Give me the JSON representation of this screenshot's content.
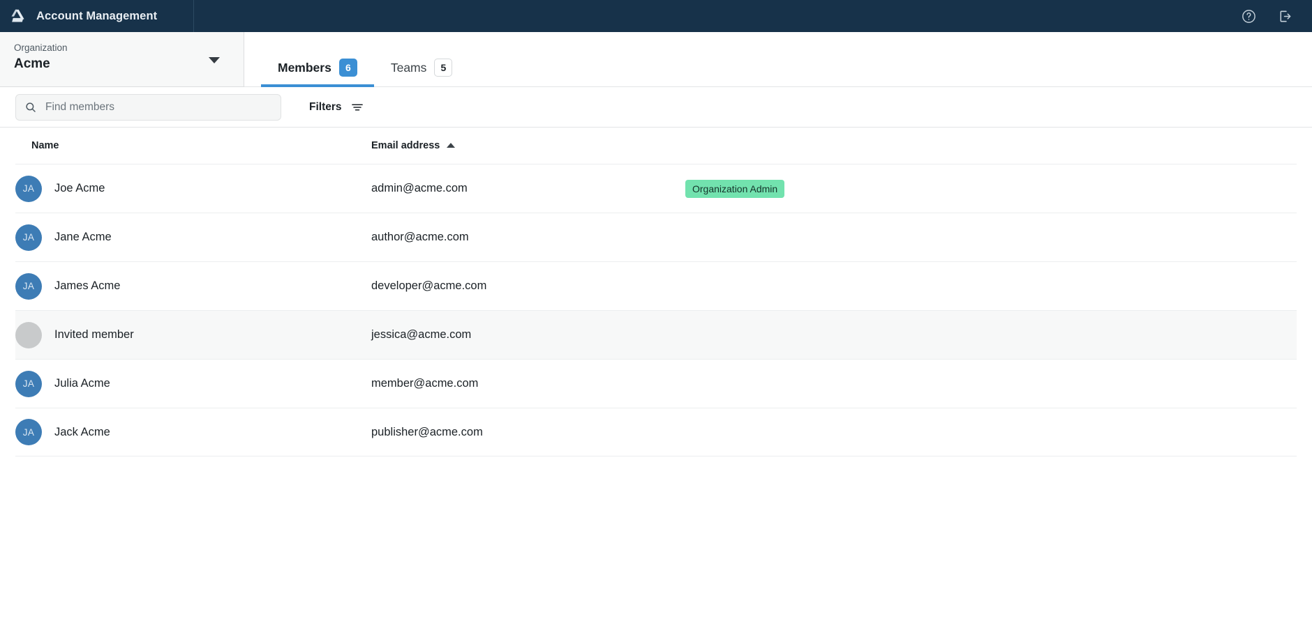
{
  "appbar": {
    "logo_icon": "drive-triangle-logo",
    "title": "Account Management",
    "help_icon": "question-circle-icon",
    "logout_icon": "sign-out-icon"
  },
  "org_selector": {
    "label": "Organization",
    "value": "Acme",
    "caret_icon": "chevron-down-icon"
  },
  "tabs": [
    {
      "label": "Members",
      "count": "6",
      "active": true
    },
    {
      "label": "Teams",
      "count": "5",
      "active": false
    }
  ],
  "toolbar": {
    "search_placeholder": "Find members",
    "search_value": "",
    "search_icon": "search-icon",
    "filters_label": "Filters",
    "filters_icon": "filter-lines-icon"
  },
  "table": {
    "columns": {
      "name": "Name",
      "email": "Email address",
      "sort_icon": "sort-ascending-caret"
    },
    "rows": [
      {
        "initials": "JA",
        "name": "Joe Acme",
        "email": "admin@acme.com",
        "role": "Organization Admin",
        "invited": false
      },
      {
        "initials": "JA",
        "name": "Jane Acme",
        "email": "author@acme.com",
        "role": "",
        "invited": false
      },
      {
        "initials": "JA",
        "name": "James Acme",
        "email": "developer@acme.com",
        "role": "",
        "invited": false
      },
      {
        "initials": "",
        "name": "Invited member",
        "email": "jessica@acme.com",
        "role": "",
        "invited": true
      },
      {
        "initials": "JA",
        "name": "Julia Acme",
        "email": "member@acme.com",
        "role": "",
        "invited": false
      },
      {
        "initials": "JA",
        "name": "Jack Acme",
        "email": "publisher@acme.com",
        "role": "",
        "invited": false
      }
    ]
  },
  "colors": {
    "appbar_bg": "#17324a",
    "accent_blue": "#3b8fd4",
    "avatar_blue": "#3d7cb5",
    "role_badge_green": "#72e2ae"
  }
}
